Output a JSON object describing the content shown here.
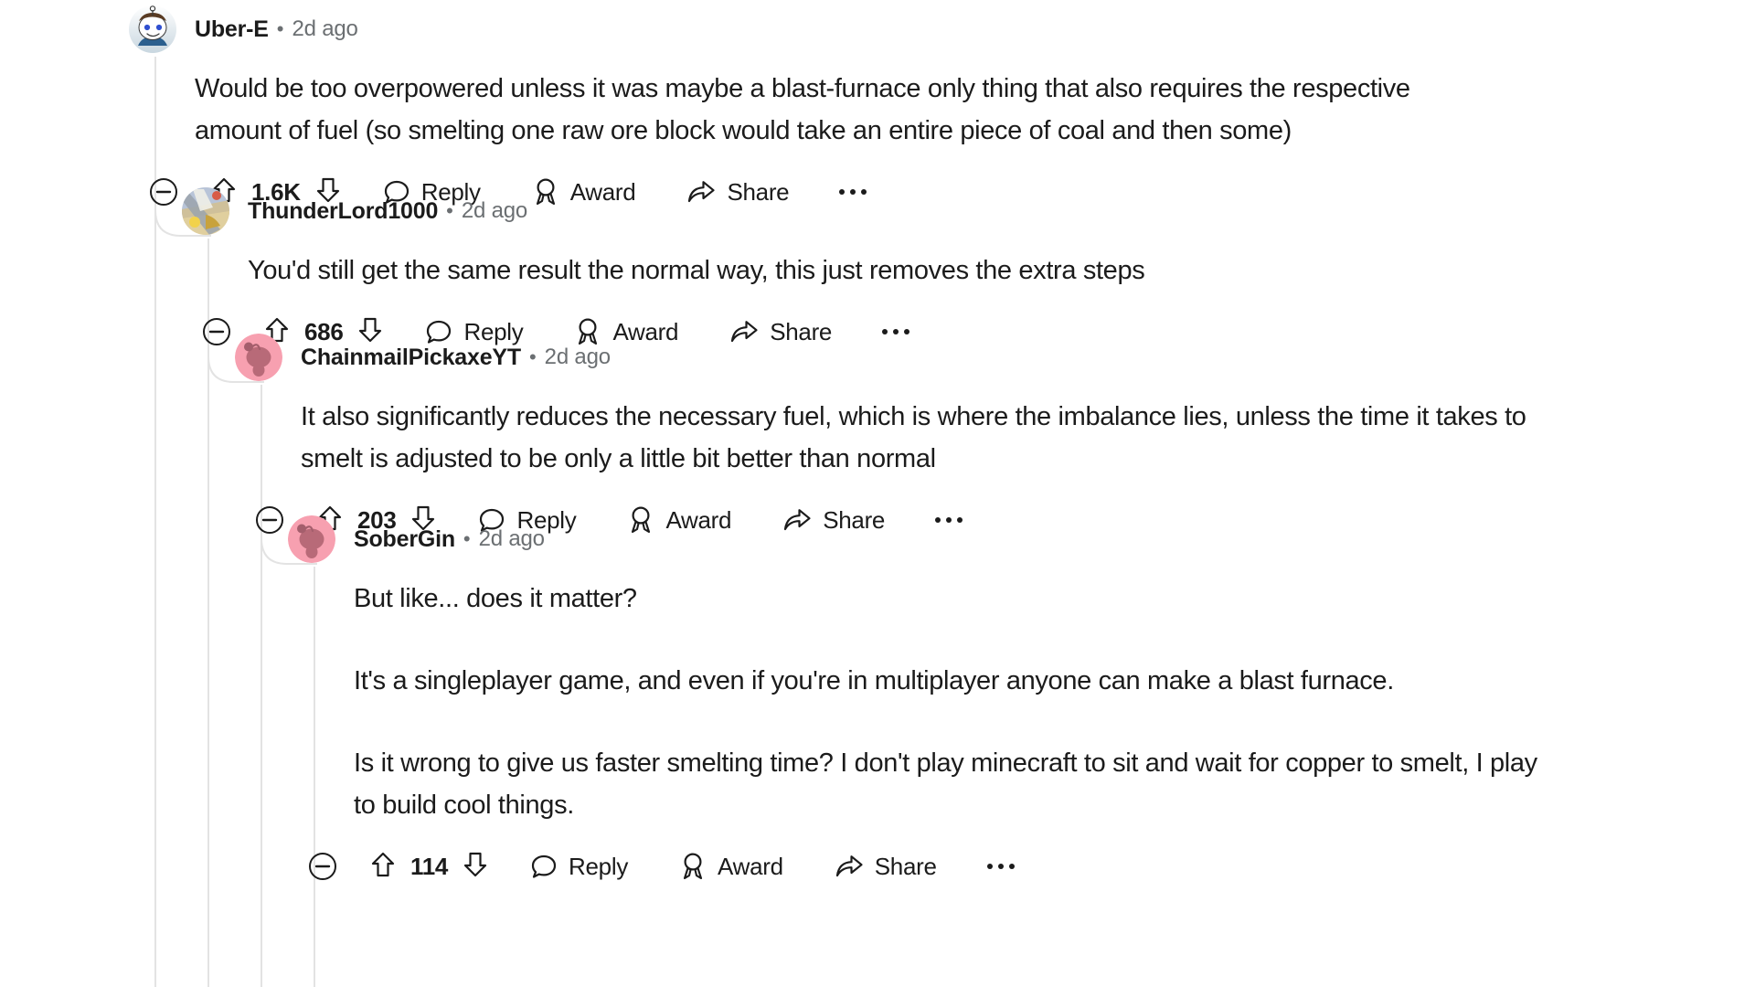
{
  "theme": {
    "background": "#ffffff",
    "text_primary": "#1b1b1b",
    "text_muted": "#6b6f72",
    "thread_line": "#e3e3e3",
    "snoo_pink": "#f7a0b0",
    "snoo_pink_body": "#b86a78"
  },
  "thread": {
    "comments": [
      {
        "id": "uber-e",
        "depth": 0,
        "username": "Uber-E",
        "separator": "•",
        "timestamp": "2d ago",
        "avatar_icon": "snoo-avatar-white",
        "paragraphs": [
          "Would be too overpowered unless it was maybe a blast-furnace only thing that also requires the respective amount of fuel (so smelting one raw ore block would take an entire piece of coal and then some)"
        ],
        "actions": {
          "collapse_icon": "collapse-minus-icon",
          "upvote_icon": "upvote-arrow-icon",
          "score": "1.6K",
          "downvote_icon": "downvote-arrow-icon",
          "reply_icon": "comment-bubble-icon",
          "reply_label": "Reply",
          "award_icon": "award-medal-icon",
          "award_label": "Award",
          "share_icon": "share-arrow-icon",
          "share_label": "Share",
          "more_icon": "more-ellipsis-icon"
        }
      },
      {
        "id": "thunderlord1000",
        "depth": 1,
        "username": "ThunderLord1000",
        "separator": "•",
        "timestamp": "2d ago",
        "avatar_icon": "custom-art-avatar",
        "paragraphs": [
          "You'd still get the same result the normal way, this just removes the extra steps"
        ],
        "actions": {
          "collapse_icon": "collapse-minus-icon",
          "upvote_icon": "upvote-arrow-icon",
          "score": "686",
          "downvote_icon": "downvote-arrow-icon",
          "reply_icon": "comment-bubble-icon",
          "reply_label": "Reply",
          "award_icon": "award-medal-icon",
          "award_label": "Award",
          "share_icon": "share-arrow-icon",
          "share_label": "Share",
          "more_icon": "more-ellipsis-icon"
        }
      },
      {
        "id": "chainmailpickaxeyt",
        "depth": 2,
        "username": "ChainmailPickaxeYT",
        "separator": "•",
        "timestamp": "2d ago",
        "avatar_icon": "snoo-avatar-pink",
        "paragraphs": [
          "It also significantly reduces the necessary fuel, which is where the imbalance lies, unless the time it takes to smelt is adjusted to be only a little bit better than normal"
        ],
        "actions": {
          "collapse_icon": "collapse-minus-icon",
          "upvote_icon": "upvote-arrow-icon",
          "score": "203",
          "downvote_icon": "downvote-arrow-icon",
          "reply_icon": "comment-bubble-icon",
          "reply_label": "Reply",
          "award_icon": "award-medal-icon",
          "award_label": "Award",
          "share_icon": "share-arrow-icon",
          "share_label": "Share",
          "more_icon": "more-ellipsis-icon"
        }
      },
      {
        "id": "sobergin",
        "depth": 3,
        "username": "SoberGin",
        "separator": "•",
        "timestamp": "2d ago",
        "avatar_icon": "snoo-avatar-pink",
        "paragraphs": [
          "But like... does it matter?",
          "It's a singleplayer game, and even if you're in multiplayer anyone can make a blast furnace.",
          "Is it wrong to give us faster smelting time? I don't play minecraft to sit and wait for copper to smelt, I play to build cool things."
        ],
        "actions": {
          "collapse_icon": "collapse-minus-icon",
          "upvote_icon": "upvote-arrow-icon",
          "score": "114",
          "downvote_icon": "downvote-arrow-icon",
          "reply_icon": "comment-bubble-icon",
          "reply_label": "Reply",
          "award_icon": "award-medal-icon",
          "award_label": "Award",
          "share_icon": "share-arrow-icon",
          "share_label": "Share",
          "more_icon": "more-ellipsis-icon"
        }
      }
    ]
  }
}
